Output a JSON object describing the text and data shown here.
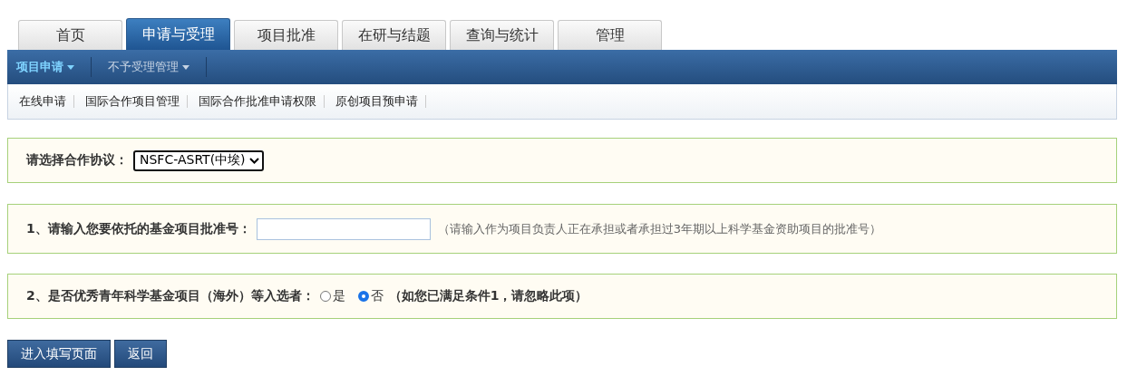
{
  "tabs": [
    {
      "label": "首页",
      "selected": false
    },
    {
      "label": "申请与受理",
      "selected": true
    },
    {
      "label": "项目批准",
      "selected": false
    },
    {
      "label": "在研与结题",
      "selected": false
    },
    {
      "label": "查询与统计",
      "selected": false
    },
    {
      "label": "管理",
      "selected": false
    }
  ],
  "menu_bar": [
    {
      "label": "项目申请",
      "selected": true
    },
    {
      "label": "不予受理管理",
      "selected": false
    }
  ],
  "sub_menu": [
    "在线申请",
    "国际合作项目管理",
    "国际合作批准申请权限",
    "原创项目预申请"
  ],
  "agreement": {
    "label": "请选择合作协议：",
    "value": "NSFC-ASRT(中埃)"
  },
  "approval_number": {
    "label": "1、请输入您要依托的基金项目批准号：",
    "hint": "（请输入作为项目负责人正在承担或者承担过3年期以上科学基金资助项目的批准号）"
  },
  "excellent_youth": {
    "label": "2、是否优秀青年科学基金项目（海外）等入选者：",
    "options": [
      {
        "label": "是",
        "selected": false
      },
      {
        "label": "否",
        "selected": true
      }
    ],
    "note": "（如您已满足条件1，请忽略此项）"
  },
  "buttons": [
    "进入填写页面",
    "返回"
  ]
}
